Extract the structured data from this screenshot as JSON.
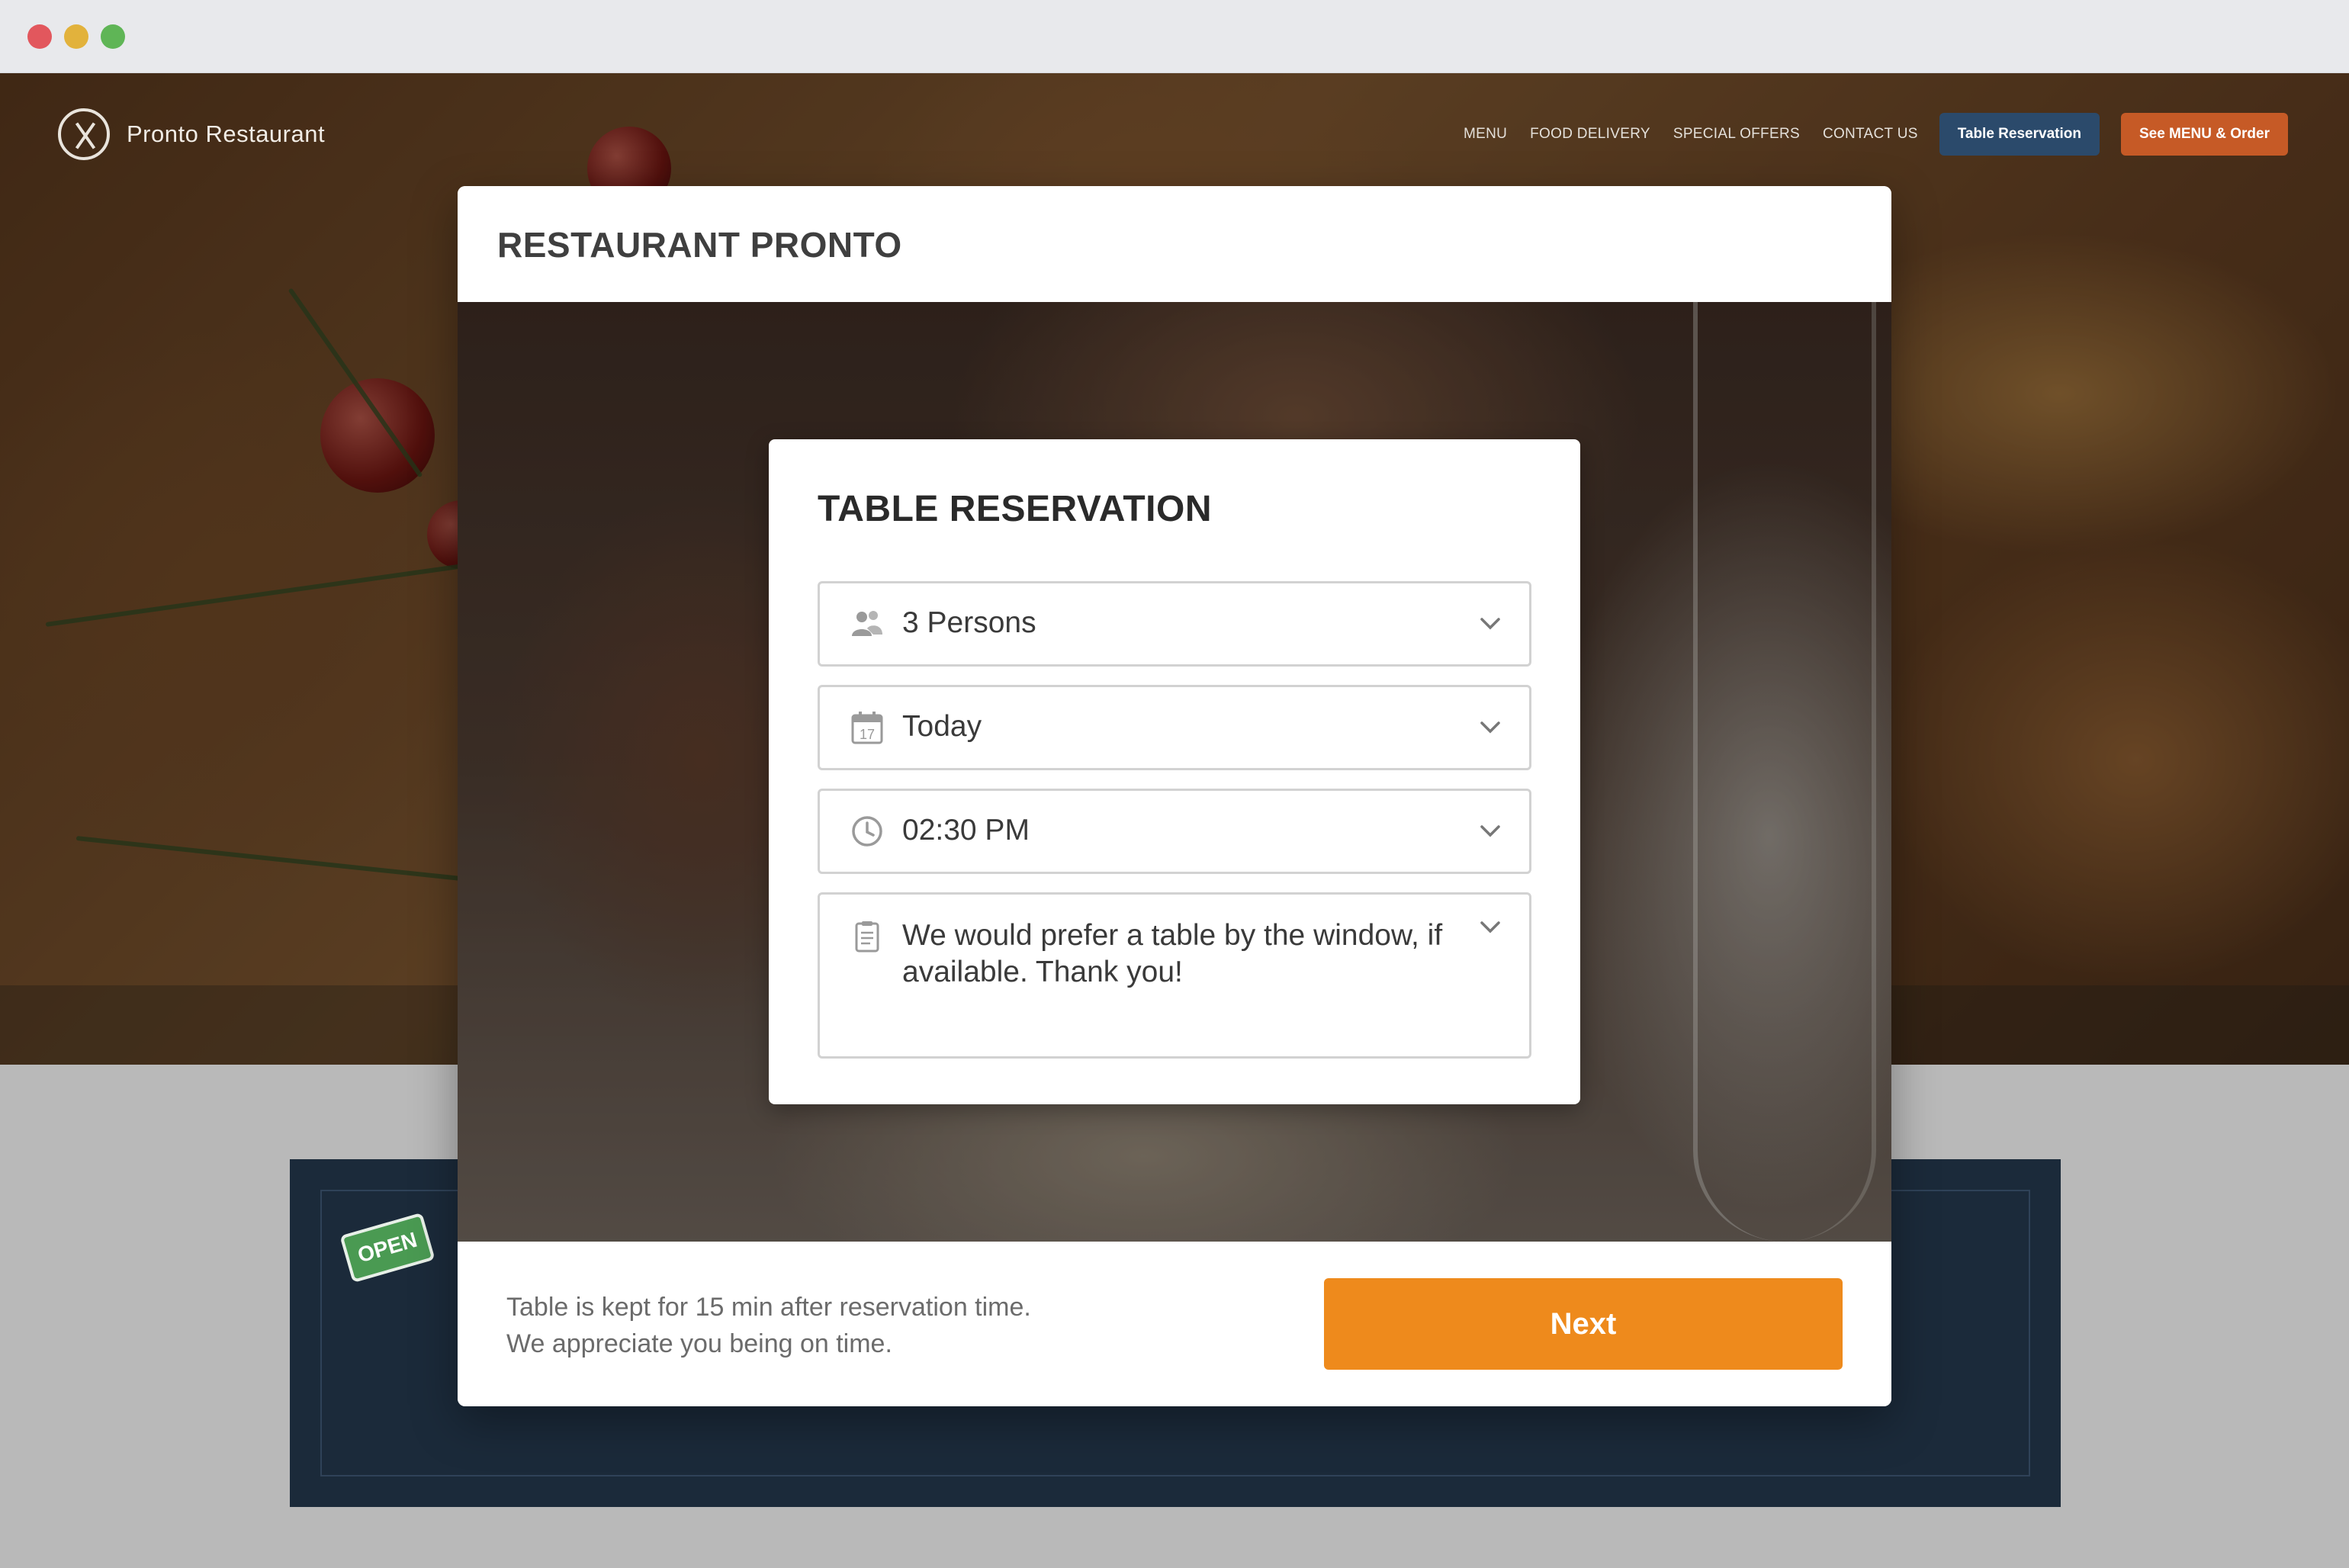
{
  "window": {
    "controls": [
      "close",
      "minimize",
      "maximize"
    ]
  },
  "site": {
    "brand": "Pronto Restaurant",
    "nav": [
      "MENU",
      "FOOD DELIVERY",
      "SPECIAL OFFERS",
      "CONTACT US"
    ],
    "buttons": {
      "reservation": "Table Reservation",
      "order": "See MENU & Order"
    },
    "open_sign": "OPEN"
  },
  "modal": {
    "title": "RESTAURANT PRONTO",
    "form": {
      "title": "TABLE RESERVATION",
      "persons": {
        "icon": "people-icon",
        "value": "3 Persons"
      },
      "date": {
        "icon": "calendar-icon",
        "value": "Today",
        "day": "17"
      },
      "time": {
        "icon": "clock-icon",
        "value": "02:30 PM"
      },
      "note": {
        "icon": "notes-icon",
        "value": "We would prefer a table by the window, if available. Thank you!"
      }
    },
    "footer": {
      "note_line1": "Table is kept for 15 min after reservation time.",
      "note_line2": "We appreciate you being on time.",
      "next": "Next"
    }
  },
  "colors": {
    "accent": "#ee8a1c",
    "nav_reservation": "#2b4a6b",
    "nav_order": "#c65a26",
    "lower_panel": "#1b2a3a"
  }
}
